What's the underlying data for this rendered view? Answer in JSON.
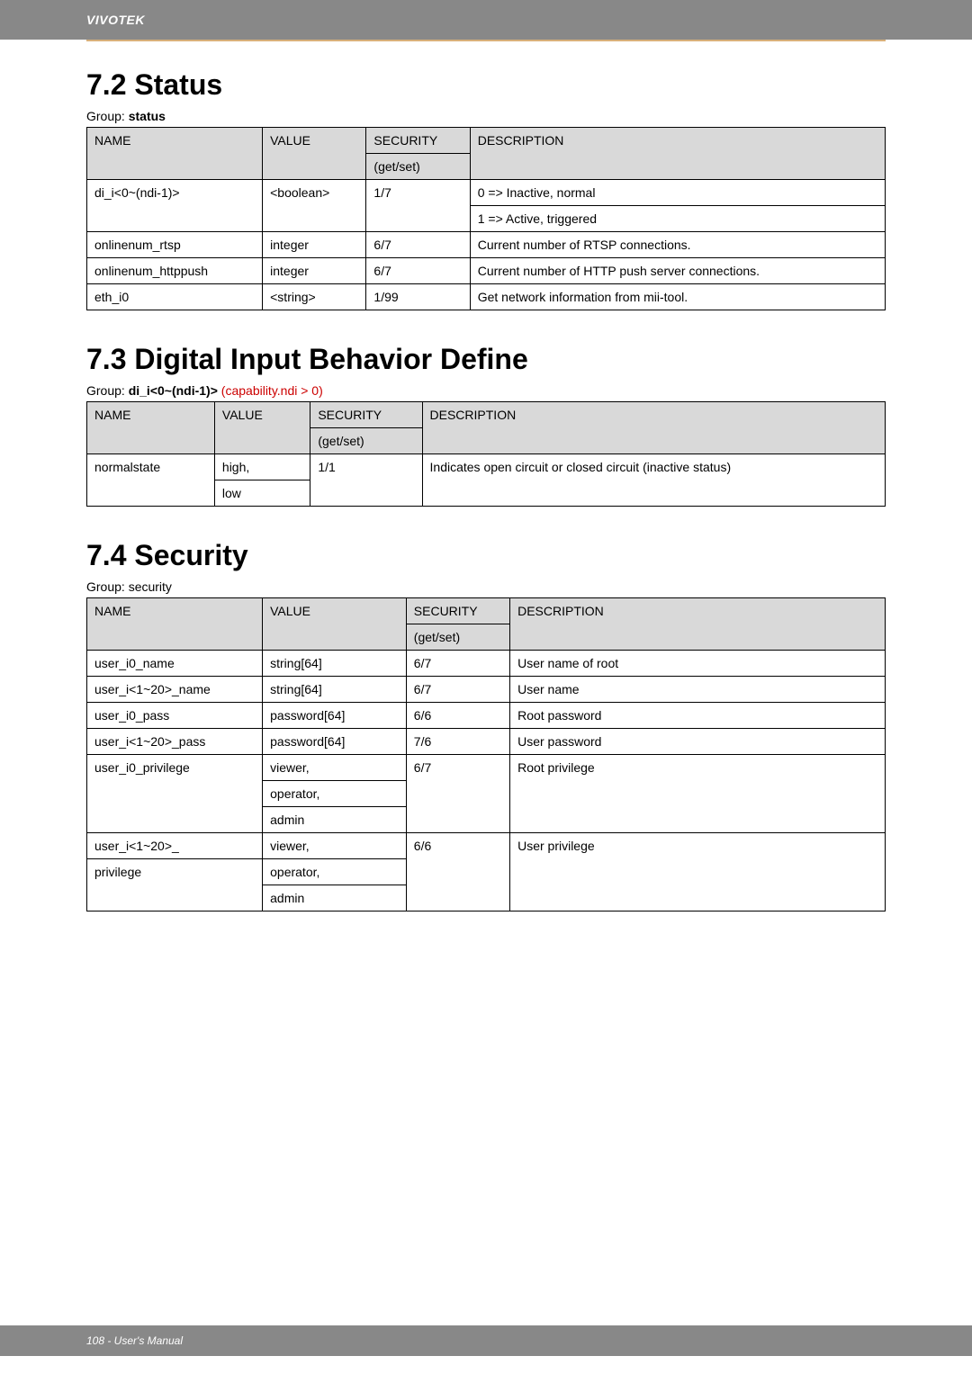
{
  "header": {
    "brand": "VIVOTEK"
  },
  "footer": {
    "text": "108 - User's Manual"
  },
  "sections": {
    "s72": {
      "title": "7.2 Status",
      "group_prefix": "Group: ",
      "group_name": "status",
      "cols": {
        "c1": "NAME",
        "c2": "VALUE",
        "c3": "SECURITY",
        "c3b": "(get/set)",
        "c4": "DESCRIPTION"
      },
      "rows": [
        {
          "name": "di_i<0~(ndi-1)>",
          "value": "<boolean>",
          "sec": "1/7",
          "desc_a": "0 => Inactive, normal",
          "desc_b": "1 => Active, triggered"
        },
        {
          "name": "onlinenum_rtsp",
          "value": "integer",
          "sec": "6/7",
          "desc": "Current number of RTSP connections."
        },
        {
          "name": "onlinenum_httppush",
          "value": "integer",
          "sec": "6/7",
          "desc": "Current number of HTTP push server connections."
        },
        {
          "name": "eth_i0",
          "value": "<string>",
          "sec": "1/99",
          "desc": "Get network information from mii-tool."
        }
      ]
    },
    "s73": {
      "title": "7.3 Digital Input Behavior Define",
      "group_prefix": "Group: ",
      "group_name": "di_i<0~(ndi-1)>",
      "group_cond": " (capability.ndi > 0)",
      "cols": {
        "c1": "NAME",
        "c2": "VALUE",
        "c3": "SECURITY",
        "c3b": "(get/set)",
        "c4": "DESCRIPTION"
      },
      "rows": [
        {
          "name": "normalstate",
          "value_a": "high,",
          "value_b": "low",
          "sec": "1/1",
          "desc": "Indicates open circuit or closed circuit (inactive status)"
        }
      ]
    },
    "s74": {
      "title": "7.4 Security",
      "group_line": "Group: security",
      "cols": {
        "c1": "NAME",
        "c2": "VALUE",
        "c3": "SECURITY",
        "c3b": "(get/set)",
        "c4": "DESCRIPTION"
      },
      "rows": [
        {
          "name": "user_i0_name",
          "value": "string[64]",
          "sec": "6/7",
          "desc": "User name of root"
        },
        {
          "name": "user_i<1~20>_name",
          "value": "string[64]",
          "sec": "6/7",
          "desc": "User name"
        },
        {
          "name": "user_i0_pass",
          "value": "password[64]",
          "sec": "6/6",
          "desc": "Root password"
        },
        {
          "name": "user_i<1~20>_pass",
          "value": "password[64]",
          "sec": "7/6",
          "desc": "User password"
        },
        {
          "name": "user_i0_privilege",
          "value_a": "viewer,",
          "value_b": "operator,",
          "value_c": "admin",
          "sec": "6/7",
          "desc": "Root privilege"
        },
        {
          "name_a": "user_i<1~20>_",
          "name_b": "privilege",
          "value_a": "viewer,",
          "value_b": "operator,",
          "value_c": "admin",
          "sec": "6/6",
          "desc": "User privilege"
        }
      ]
    }
  }
}
